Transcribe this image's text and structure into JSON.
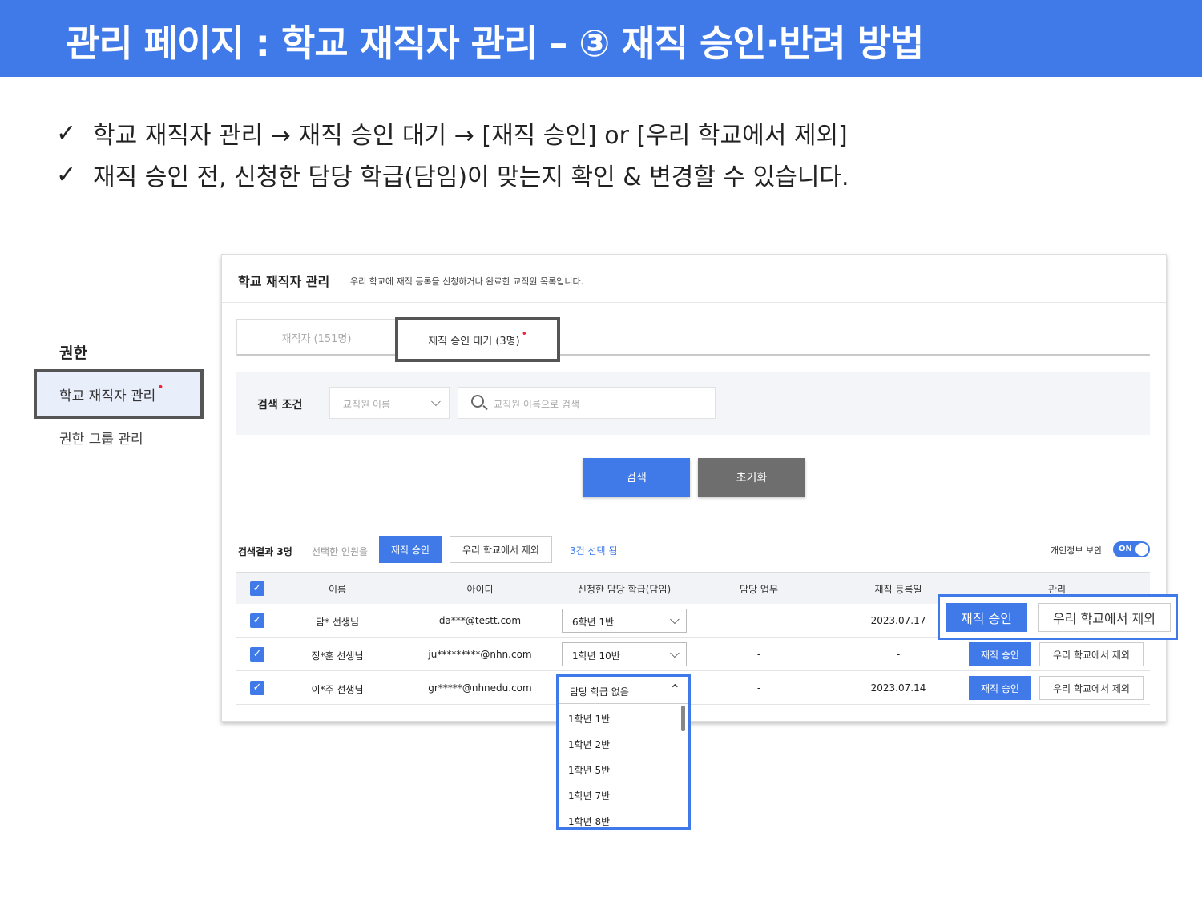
{
  "banner": {
    "title": "관리 페이지 : 학교 재직자 관리 – ③ 재직 승인·반려 방법"
  },
  "bullets": [
    {
      "mark": "✓",
      "text": "학교 재직자 관리 → 재직 승인 대기 → [재직 승인] or [우리 학교에서 제외]"
    },
    {
      "mark": "✓",
      "text": "재직 승인 전, 신청한 담당 학급(담임)이 맞는지 확인 & 변경할 수 있습니다."
    }
  ],
  "sidebar": {
    "heading": "권한",
    "items": [
      {
        "label": "학교 재직자 관리",
        "active": true,
        "dot": "•"
      },
      {
        "label": "권한 그룹 관리",
        "active": false
      }
    ]
  },
  "panel": {
    "title": "학교 재직자 관리",
    "description": "우리 학교에 재직 등록을 신청하거나 완료한 교직원 목록입니다.",
    "tabs": [
      {
        "label": "재직자 (151명)"
      },
      {
        "label": "재직 승인 대기 (3명)",
        "dot": "•"
      }
    ],
    "search": {
      "label": "검색 조건",
      "select_value": "교직원 이름",
      "input_placeholder": "교직원 이름으로 검색",
      "search_button": "검색",
      "reset_button": "초기화"
    },
    "results": {
      "count": "검색결과 3명",
      "selected_label": "선택한 인원을",
      "approve_button": "재직 승인",
      "exclude_button": "우리 학교에서 제외",
      "selected_count": "3건 선택 됨",
      "privacy_label": "개인정보 보안",
      "privacy_toggle": "ON"
    },
    "table": {
      "columns": [
        "이름",
        "아이디",
        "신청한 담당 학급(담임)",
        "담당 업무",
        "재직 등록일",
        "관리"
      ],
      "rows": [
        {
          "name": "담* 선생님",
          "id": "da***@testt.com",
          "class": "6학년 1반",
          "duty": "-",
          "date": "2023.07.17",
          "approve": "재직 승인",
          "exclude": "우리 학교에서 제외"
        },
        {
          "name": "정*훈 선생님",
          "id": "ju*********@nhn.com",
          "class": "1학년 10반",
          "duty": "-",
          "date": "-",
          "approve": "재직 승인",
          "exclude": "우리 학교에서 제외"
        },
        {
          "name": "이*주 선생님",
          "id": "gr*****@nhnedu.com",
          "class": "담당 학급 없음",
          "duty": "-",
          "date": "2023.07.14",
          "approve": "재직 승인",
          "exclude": "우리 학교에서 제외"
        }
      ]
    },
    "dropdown": {
      "selected": "담당 학급 없음",
      "options": [
        "1학년 1반",
        "1학년 2반",
        "1학년 5반",
        "1학년 7반",
        "1학년 8반"
      ]
    }
  },
  "highlight": {
    "approve": "재직 승인",
    "exclude": "우리 학교에서 제외"
  },
  "icons": {
    "dropdown": "chevron-down-icon",
    "search": "search-icon",
    "checkbox": "checkbox-checked-icon"
  },
  "colors": {
    "accent": "#3f7ae8",
    "reset": "#6e6e6e",
    "dot": "#e22233"
  }
}
